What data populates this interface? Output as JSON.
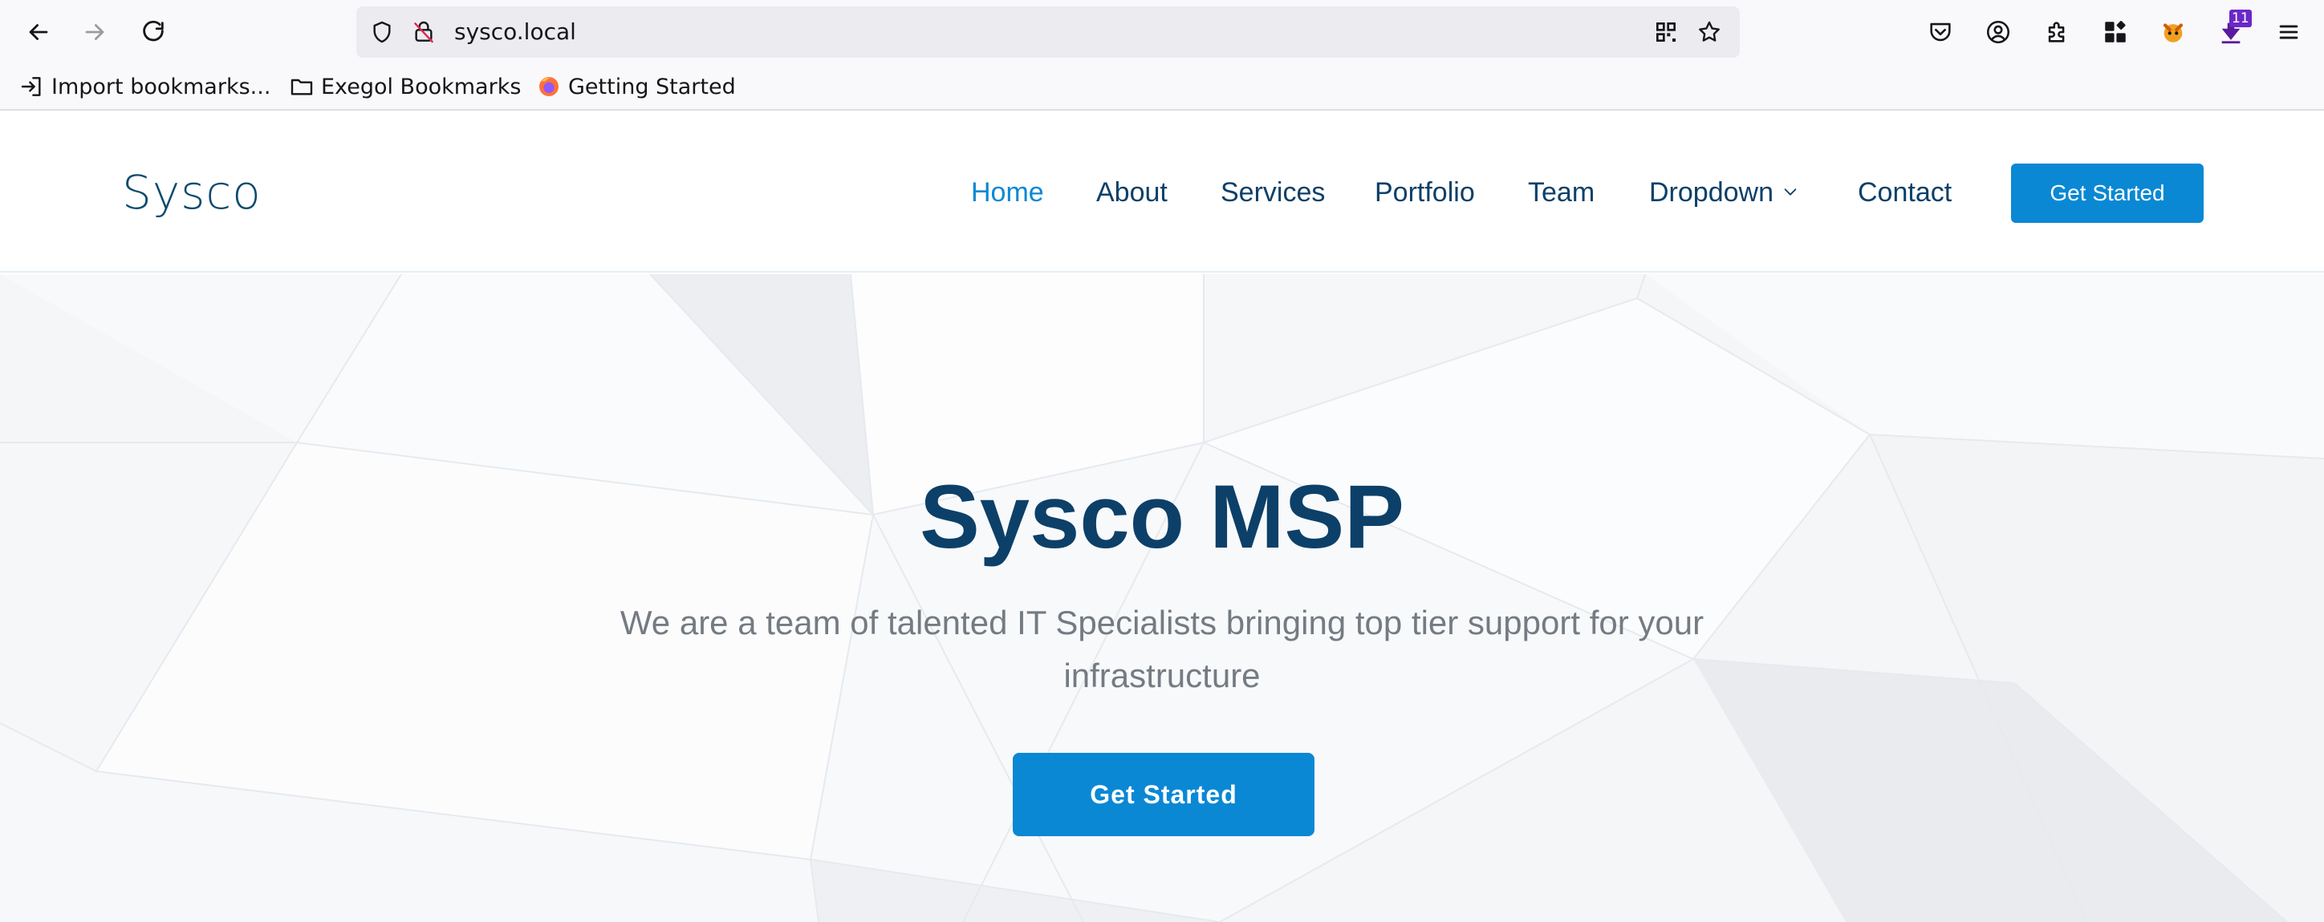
{
  "browser": {
    "url": "sysco.local",
    "extension_badge": "11",
    "bookmarks": [
      {
        "label": "Import bookmarks...",
        "icon": "import-icon"
      },
      {
        "label": "Exegol Bookmarks",
        "icon": "folder-icon"
      },
      {
        "label": "Getting Started",
        "icon": "firefox-icon"
      }
    ]
  },
  "site": {
    "logo": "Sysco",
    "nav": [
      {
        "label": "Home",
        "active": true
      },
      {
        "label": "About"
      },
      {
        "label": "Services"
      },
      {
        "label": "Portfolio"
      },
      {
        "label": "Team"
      },
      {
        "label": "Dropdown",
        "has_chevron": true
      },
      {
        "label": "Contact"
      }
    ],
    "nav_cta": "Get Started",
    "hero": {
      "title": "Sysco MSP",
      "subtitle": "We are a team of talented IT Specialists bringing top tier support for your infrastructure",
      "cta": "Get Started"
    }
  },
  "colors": {
    "accent": "#0a88d4",
    "heading": "#0c4068",
    "subtext": "#747b82"
  }
}
